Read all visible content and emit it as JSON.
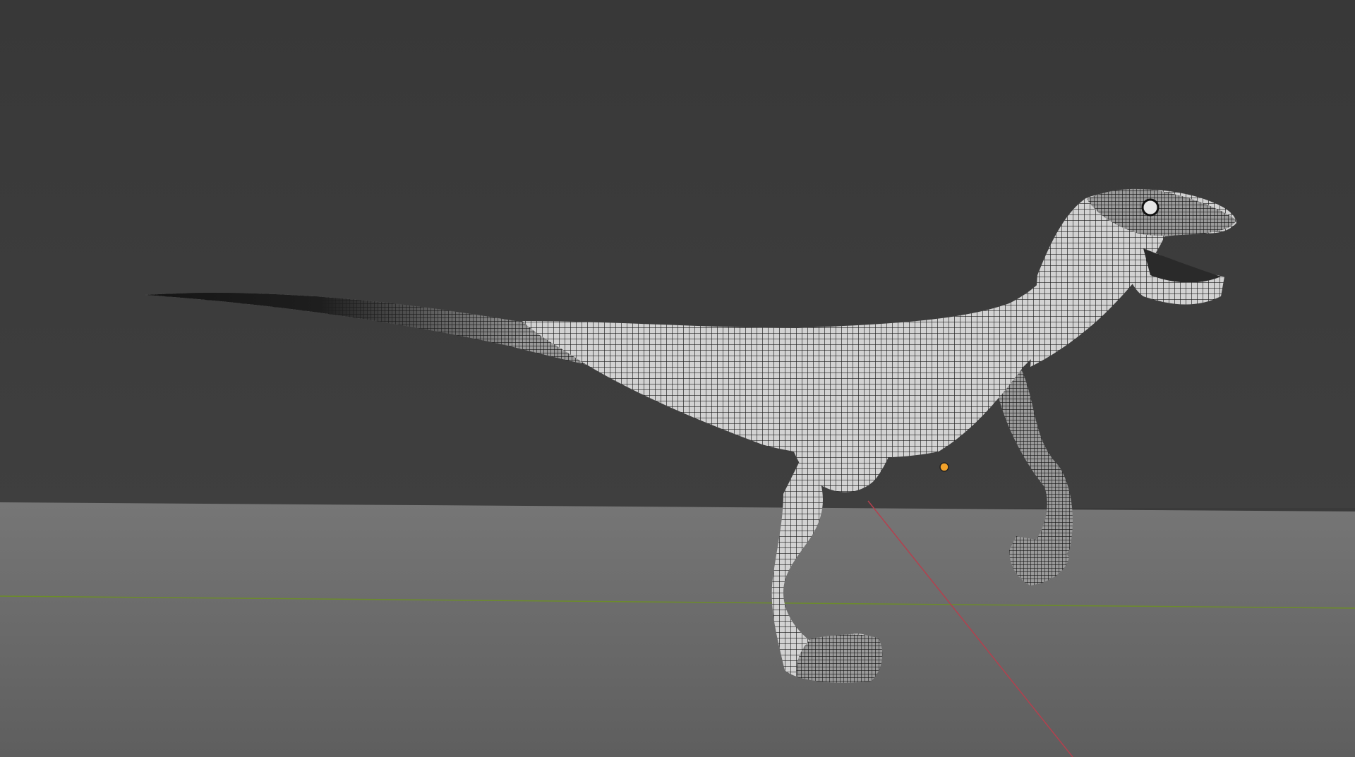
{
  "viewport": {
    "mode": "3d-viewport",
    "shading": "wireframe",
    "selected_object": "raptor-mesh",
    "colors": {
      "background": "#3a3a3a",
      "floor": "#6e6e6e",
      "x_axis": "#b4404e",
      "y_axis": "#6c8c2a",
      "mesh_fill": "#c8c8c8",
      "mesh_wire": "#1c1c1c",
      "origin": "#f2a22a"
    }
  }
}
